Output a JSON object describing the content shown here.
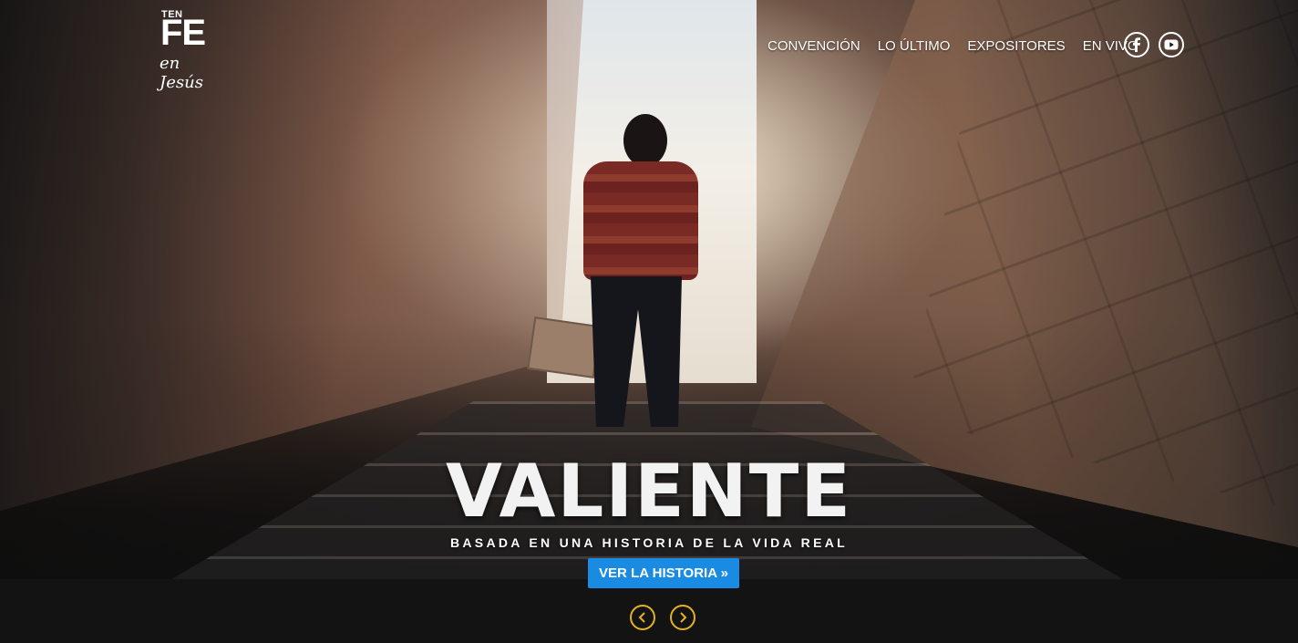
{
  "logo": {
    "line1": "TEN",
    "line2": "FE",
    "line3": "en Jesús"
  },
  "nav": {
    "items": [
      {
        "label": "CONVENCIÓN"
      },
      {
        "label": "LO ÚLTIMO"
      },
      {
        "label": "EXPOSITORES"
      },
      {
        "label": "EN VIVO"
      }
    ]
  },
  "social": {
    "icons": [
      "facebook-icon",
      "youtube-icon"
    ]
  },
  "hero": {
    "title": "VALIENTE",
    "subtitle": "BASADA EN UNA HISTORIA DE LA VIDA REAL",
    "cta_label": "VER LA HISTORIA »"
  },
  "slider": {
    "prev_icon": "chevron-left-icon",
    "next_icon": "chevron-right-icon"
  },
  "colors": {
    "accent": "#1a8be2",
    "arrow": "#e6b21c",
    "background": "#131313"
  }
}
